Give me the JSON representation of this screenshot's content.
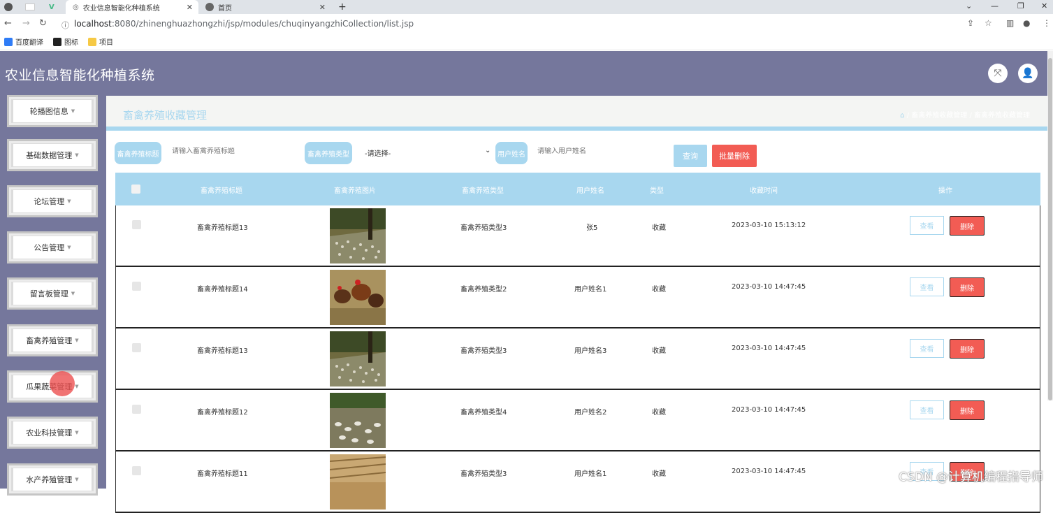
{
  "browser": {
    "tabs": [
      {
        "label": "农业信息智能化种植系统"
      },
      {
        "label": "首页"
      }
    ],
    "new_tab": "+",
    "url_host": "localhost",
    "url_path": ":8080/zhinenghuazhongzhi/jsp/modules/chuqinyangzhiCollection/list.jsp",
    "bookmarks": [
      {
        "label": "百度翻译",
        "color": "#2f7cf6"
      },
      {
        "label": "图标",
        "color": "#222222"
      },
      {
        "label": "项目",
        "color": "#f6c945"
      }
    ]
  },
  "app": {
    "title": "农业信息智能化种植系统",
    "accent": "#a8d7ef",
    "header_bg": "#75779c",
    "danger": "#f25c54"
  },
  "sidebar": {
    "items": [
      {
        "label": "轮播图信息"
      },
      {
        "label": "基础数据管理"
      },
      {
        "label": "论坛管理"
      },
      {
        "label": "公告管理"
      },
      {
        "label": "留言板管理"
      },
      {
        "label": "畜禽养殖管理"
      },
      {
        "label": "瓜果蔬菜管理"
      },
      {
        "label": "农业科技管理"
      },
      {
        "label": "水产养殖管理"
      }
    ]
  },
  "page": {
    "title": "畜禽养殖收藏管理",
    "breadcrumb": [
      "畜禽养殖收藏管理",
      "畜禽养殖收藏管理"
    ]
  },
  "search": {
    "title_label": "畜禽养殖标题",
    "title_placeholder": "请输入畜禽养殖标题",
    "type_label": "畜禽养殖类型",
    "type_selected": "-请选择-",
    "user_label": "用户姓名",
    "user_placeholder": "请输入用户姓名",
    "query_button": "查询",
    "batch_delete_button": "批量删除"
  },
  "table": {
    "columns": [
      "畜禽养殖标题",
      "畜禽养殖图片",
      "畜禽养殖类型",
      "用户姓名",
      "类型",
      "收藏时间",
      "操作"
    ],
    "view_label": "查看",
    "delete_label": "删除",
    "rows": [
      {
        "title": "畜禽养殖标题13",
        "image": "ducks-field",
        "type": "畜禽养殖类型3",
        "user": "张5",
        "kind": "收藏",
        "time": "2023-03-10 15:13:12"
      },
      {
        "title": "畜禽养殖标题14",
        "image": "chickens",
        "type": "畜禽养殖类型2",
        "user": "用户姓名1",
        "kind": "收藏",
        "time": "2023-03-10 14:47:45"
      },
      {
        "title": "畜禽养殖标题13",
        "image": "ducks-field",
        "type": "畜禽养殖类型3",
        "user": "用户姓名3",
        "kind": "收藏",
        "time": "2023-03-10 14:47:45"
      },
      {
        "title": "畜禽养殖标题12",
        "image": "geese-farm",
        "type": "畜禽养殖类型4",
        "user": "用户姓名2",
        "kind": "收藏",
        "time": "2023-03-10 14:47:45"
      },
      {
        "title": "畜禽养殖标题11",
        "image": "poultry-house",
        "type": "畜禽养殖类型3",
        "user": "用户姓名1",
        "kind": "收藏",
        "time": "2023-03-10 14:47:45"
      }
    ]
  },
  "watermark": "CSDN @计算机编程指导师"
}
